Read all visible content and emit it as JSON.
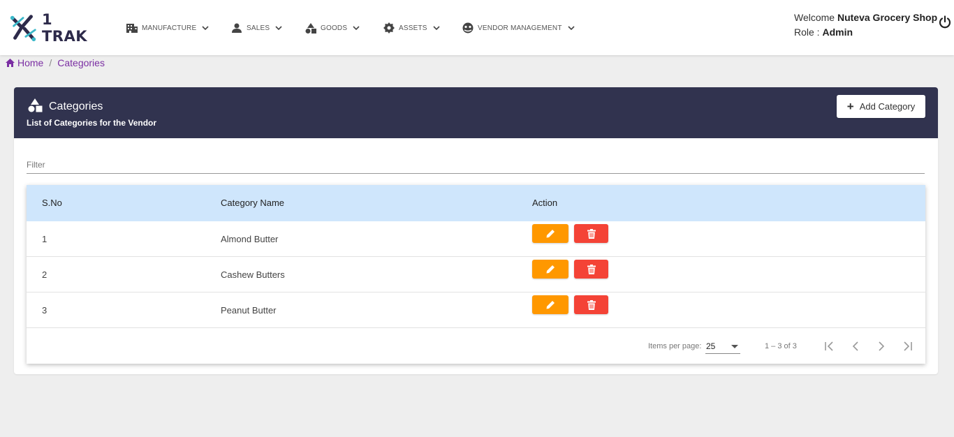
{
  "app": {
    "logo_text": "1 TRAK"
  },
  "nav": [
    {
      "label": "MANUFACTURE",
      "icon": "building-icon"
    },
    {
      "label": "SALES",
      "icon": "person-icon"
    },
    {
      "label": "GOODS",
      "icon": "shapes-icon"
    },
    {
      "label": "ASSETS",
      "icon": "gear-icon"
    },
    {
      "label": "VENDOR MANAGEMENT",
      "icon": "handshake-icon"
    }
  ],
  "user": {
    "welcome_prefix": "Welcome",
    "name": "Nuteva Grocery Shop",
    "role_prefix": "Role :",
    "role": "Admin"
  },
  "breadcrumb": {
    "home": "Home",
    "separator": "/",
    "current": "Categories"
  },
  "card": {
    "title": "Categories",
    "subtitle": "List of Categories for the Vendor",
    "add_button": "Add Category",
    "filter_placeholder": "Filter"
  },
  "table": {
    "columns": [
      "S.No",
      "Category Name",
      "Action"
    ],
    "rows": [
      {
        "sno": "1",
        "name": "Almond Butter"
      },
      {
        "sno": "2",
        "name": "Cashew Butters"
      },
      {
        "sno": "3",
        "name": "Peanut Butter"
      }
    ]
  },
  "paginator": {
    "items_per_page_label": "Items per page:",
    "page_size": "25",
    "range": "1 – 3 of 3"
  },
  "colors": {
    "header_bg": "#31334f",
    "table_head_bg": "#cfe6fc",
    "edit": "#ff9800",
    "delete": "#f44336",
    "breadcrumb": "#7b2fa3"
  }
}
